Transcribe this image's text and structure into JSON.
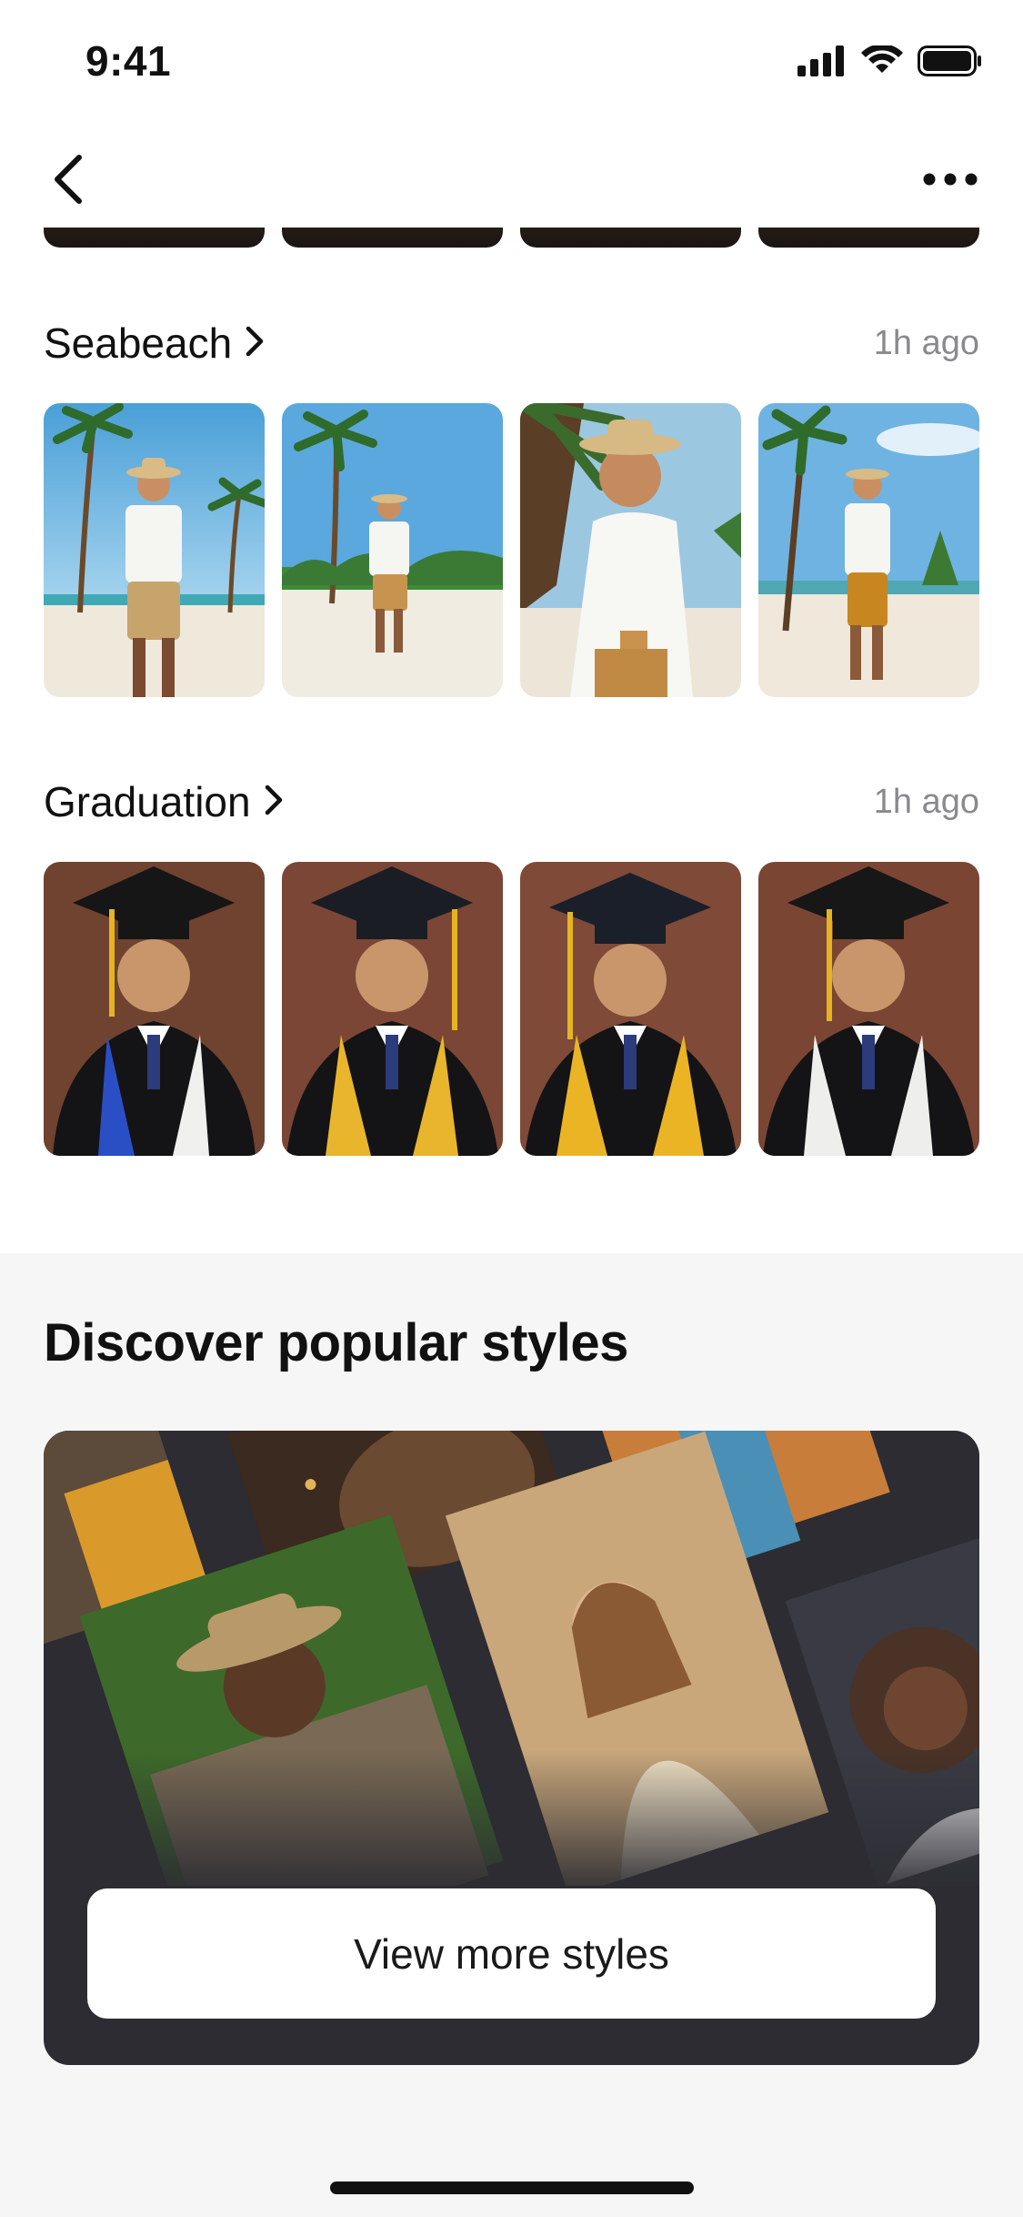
{
  "status_bar": {
    "time": "9:41",
    "icons": [
      "cellular-signal-icon",
      "wifi-icon",
      "battery-icon"
    ]
  },
  "nav": {
    "back_icon": "chevron-left-icon",
    "more_icon": "ellipsis-icon"
  },
  "sections": [
    {
      "title": "Seabeach",
      "time": "1h ago",
      "photos": [
        "seabeach-photo-1",
        "seabeach-photo-2",
        "seabeach-photo-3",
        "seabeach-photo-4"
      ]
    },
    {
      "title": "Graduation",
      "time": "1h ago",
      "photos": [
        "graduation-photo-1",
        "graduation-photo-2",
        "graduation-photo-3",
        "graduation-photo-4"
      ]
    }
  ],
  "discover": {
    "title": "Discover popular styles",
    "button_label": "View more styles"
  },
  "colors": {
    "accent_dark": "#2c2c32",
    "muted_text": "#8a8a8e",
    "discover_bg": "#f6f6f7"
  }
}
